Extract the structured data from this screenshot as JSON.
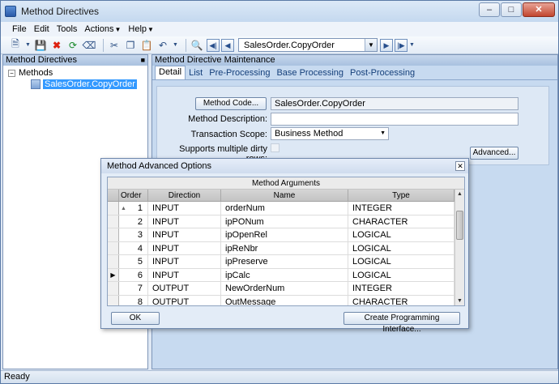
{
  "window": {
    "title": "Method Directives",
    "status": "Ready"
  },
  "menu": [
    "File",
    "Edit",
    "Tools",
    "Actions",
    "Help"
  ],
  "toolbar": {
    "record_value": "SalesOrder.CopyOrder"
  },
  "left_panel": {
    "title": "Method Directives",
    "tree_root": "Methods",
    "tree_child": "SalesOrder.CopyOrder"
  },
  "right_panel": {
    "title": "Method Directive Maintenance",
    "tabs": [
      "Detail",
      "List",
      "Pre-Processing",
      "Base Processing",
      "Post-Processing"
    ],
    "active_tab": "Detail",
    "method_code_button": "Method Code...",
    "method_code_value": "SalesOrder.CopyOrder",
    "method_description_label": "Method Description:",
    "method_description_value": "",
    "transaction_scope_label": "Transaction Scope:",
    "transaction_scope_value": "Business Method",
    "supports_dirty_rows_label": "Supports multiple dirty rows:",
    "advanced_button": "Advanced..."
  },
  "dialog": {
    "title": "Method Advanced Options",
    "grid_caption": "Method Arguments",
    "columns": [
      "Order",
      "Direction",
      "Name",
      "Type"
    ],
    "rows": [
      {
        "order": "1",
        "direction": "INPUT",
        "name": "orderNum",
        "type": "INTEGER"
      },
      {
        "order": "2",
        "direction": "INPUT",
        "name": "ipPONum",
        "type": "CHARACTER"
      },
      {
        "order": "3",
        "direction": "INPUT",
        "name": "ipOpenRel",
        "type": "LOGICAL"
      },
      {
        "order": "4",
        "direction": "INPUT",
        "name": "ipReNbr",
        "type": "LOGICAL"
      },
      {
        "order": "5",
        "direction": "INPUT",
        "name": "ipPreserve",
        "type": "LOGICAL"
      },
      {
        "order": "6",
        "direction": "INPUT",
        "name": "ipCalc",
        "type": "LOGICAL"
      },
      {
        "order": "7",
        "direction": "OUTPUT",
        "name": "NewOrderNum",
        "type": "INTEGER"
      },
      {
        "order": "8",
        "direction": "OUTPUT",
        "name": "OutMessage",
        "type": "CHARACTER"
      }
    ],
    "current_row_marker": "▶",
    "ok_button": "OK",
    "create_interface_button": "Create Programming Interface..."
  }
}
